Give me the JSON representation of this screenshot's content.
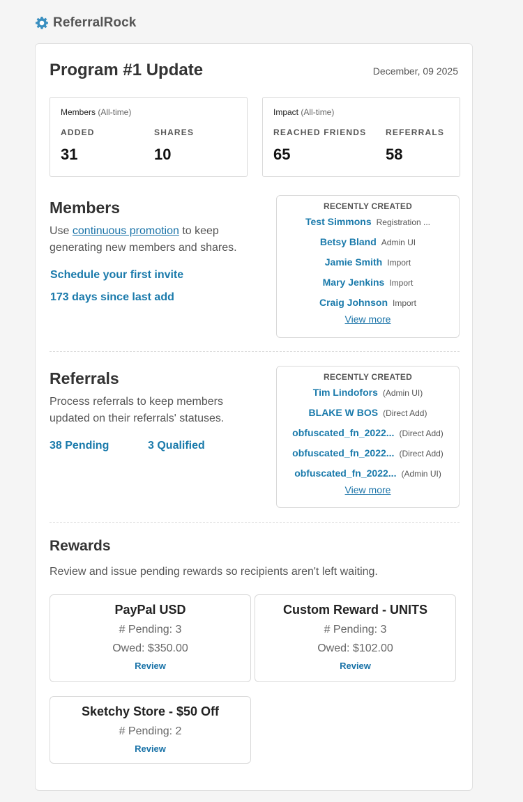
{
  "brand": {
    "name": "ReferralRock",
    "icon": "gear-icon",
    "color": "#3a8fc0"
  },
  "header": {
    "title": "Program #1 Update",
    "date": "December, 09 2025"
  },
  "members_box": {
    "title": "Members",
    "sub": "(All-time)",
    "stats": [
      {
        "label": "ADDED",
        "value": "31"
      },
      {
        "label": "SHARES",
        "value": "10"
      }
    ]
  },
  "impact_box": {
    "title": "Impact",
    "sub": "(All-time)",
    "stats": [
      {
        "label": "REACHED FRIENDS",
        "value": "65"
      },
      {
        "label": "REFERRALS",
        "value": "58"
      }
    ]
  },
  "members_section": {
    "title": "Members",
    "text_before": "Use ",
    "link": "continuous promotion",
    "text_after": " to keep generating new members and shares.",
    "action1": "Schedule your first invite",
    "action2": "173 days since last add",
    "recent": {
      "heading": "RECENTLY CREATED",
      "items": [
        {
          "name": "Test Simmons",
          "source": "Registration ..."
        },
        {
          "name": "Betsy Bland",
          "source": "Admin UI"
        },
        {
          "name": "Jamie Smith",
          "source": "Import"
        },
        {
          "name": "Mary Jenkins",
          "source": "Import"
        },
        {
          "name": "Craig Johnson",
          "source": "Import"
        }
      ],
      "more": "View more"
    }
  },
  "referrals_section": {
    "title": "Referrals",
    "text": "Process referrals to keep members updated on their referrals' statuses.",
    "pending": "38 Pending",
    "qualified": "3 Qualified",
    "recent": {
      "heading": "RECENTLY CREATED",
      "items": [
        {
          "name": "Tim Lindofors",
          "source": "(Admin UI)"
        },
        {
          "name": "BLAKE W BOS",
          "source": "(Direct Add)"
        },
        {
          "name": "obfuscated_fn_2022...",
          "source": "(Direct Add)"
        },
        {
          "name": "obfuscated_fn_2022...",
          "source": "(Direct Add)"
        },
        {
          "name": "obfuscated_fn_2022...",
          "source": "(Admin UI)"
        }
      ],
      "more": "View more"
    }
  },
  "rewards_section": {
    "title": "Rewards",
    "text": "Review and issue pending rewards so recipients aren't left waiting.",
    "cards": [
      {
        "title": "PayPal USD",
        "pending": "# Pending: 3",
        "owed": "Owed: $350.00",
        "action": "Review"
      },
      {
        "title": "Custom Reward - UNITS",
        "pending": "# Pending: 3",
        "owed": "Owed: $102.00",
        "action": "Review"
      },
      {
        "title": "Sketchy Store - $50 Off",
        "pending": "# Pending: 2",
        "action": "Review"
      }
    ]
  }
}
